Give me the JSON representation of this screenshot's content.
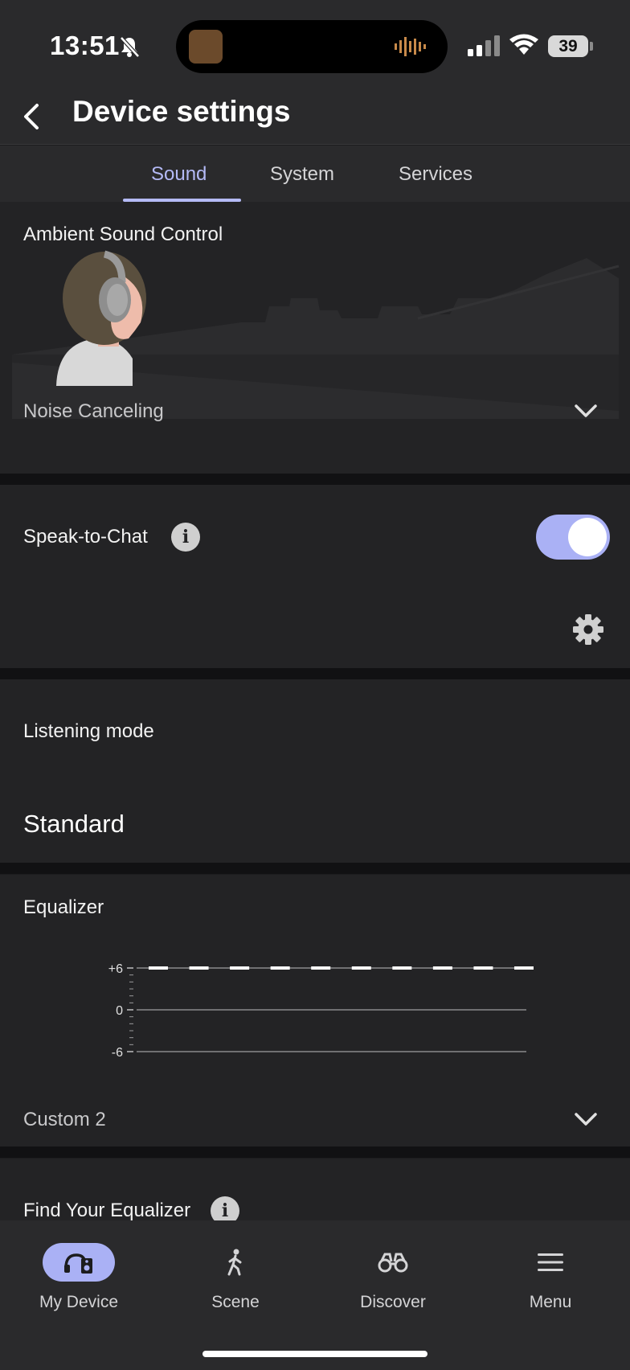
{
  "status_bar": {
    "time": "13:51",
    "battery": "39"
  },
  "header": {
    "title": "Device settings"
  },
  "tabs": [
    {
      "label": "Sound",
      "active": true
    },
    {
      "label": "System",
      "active": false
    },
    {
      "label": "Services",
      "active": false
    }
  ],
  "ambient": {
    "title": "Ambient Sound Control",
    "mode": "Noise Canceling"
  },
  "speak_to_chat": {
    "label": "Speak-to-Chat",
    "enabled": true
  },
  "listening_mode": {
    "title": "Listening mode",
    "value": "Standard"
  },
  "equalizer": {
    "title": "Equalizer",
    "preset": "Custom 2",
    "y_labels": [
      "+6",
      "0",
      "-6"
    ]
  },
  "chart_data": {
    "type": "line",
    "title": "Equalizer",
    "xlabel": "",
    "ylabel": "",
    "ylim": [
      -6,
      6
    ],
    "yticks": [
      "+6",
      "0",
      "-6"
    ],
    "series": [
      {
        "values": [
          6,
          6,
          6,
          6,
          6,
          6,
          6,
          6,
          6,
          6
        ]
      }
    ],
    "grid": true
  },
  "find_equalizer": {
    "label": "Find Your Equalizer"
  },
  "bottom_nav": [
    {
      "label": "My Device",
      "icon": "headphones-speaker-icon",
      "active": true
    },
    {
      "label": "Scene",
      "icon": "walking-person-icon",
      "active": false
    },
    {
      "label": "Discover",
      "icon": "binoculars-icon",
      "active": false
    },
    {
      "label": "Menu",
      "icon": "hamburger-menu-icon",
      "active": false
    }
  ],
  "colors": {
    "accent": "#b4baf6",
    "toggle": "#aab1f5",
    "background": "#232325"
  }
}
